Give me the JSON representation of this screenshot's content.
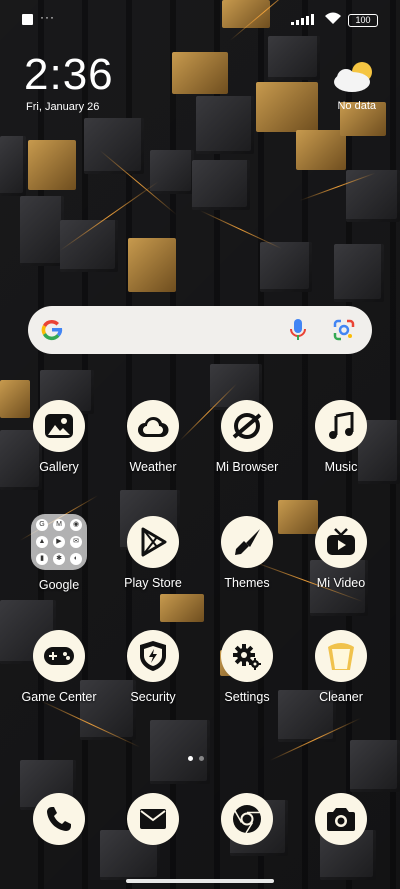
{
  "status_bar": {
    "notification_dots": "···",
    "battery": "100"
  },
  "clock_widget": {
    "time": "2:36",
    "date": "Fri, January 26",
    "weather_icon": "partly-cloudy-icon",
    "weather_text": "No data"
  },
  "search_bar": {
    "logo": "google-g-logo",
    "mic_icon": "microphone-icon",
    "lens_icon": "google-lens-icon"
  },
  "apps": [
    {
      "label": "Gallery",
      "icon": "gallery-icon"
    },
    {
      "label": "Weather",
      "icon": "weather-icon"
    },
    {
      "label": "Mi Browser",
      "icon": "browser-icon"
    },
    {
      "label": "Music",
      "icon": "music-icon"
    },
    {
      "label": "Google",
      "icon": "folder-icon"
    },
    {
      "label": "Play Store",
      "icon": "play-store-icon"
    },
    {
      "label": "Themes",
      "icon": "themes-brush-icon"
    },
    {
      "label": "Mi Video",
      "icon": "video-icon"
    },
    {
      "label": "Game Center",
      "icon": "gamepad-icon"
    },
    {
      "label": "Security",
      "icon": "security-shield-icon"
    },
    {
      "label": "Settings",
      "icon": "settings-gear-icon"
    },
    {
      "label": "Cleaner",
      "icon": "cleaner-bin-icon"
    }
  ],
  "pager": {
    "pages": 2,
    "current": 1
  },
  "dock": [
    {
      "icon": "phone-icon"
    },
    {
      "icon": "mail-icon"
    },
    {
      "icon": "chrome-icon"
    },
    {
      "icon": "camera-icon"
    }
  ],
  "colors": {
    "icon_bg": "#fbf6e6",
    "icon_fg": "#111111",
    "search_bg": "#f1efec",
    "wallpaper_gold": "#c79a4e",
    "wallpaper_dark": "#1d1d1f"
  }
}
